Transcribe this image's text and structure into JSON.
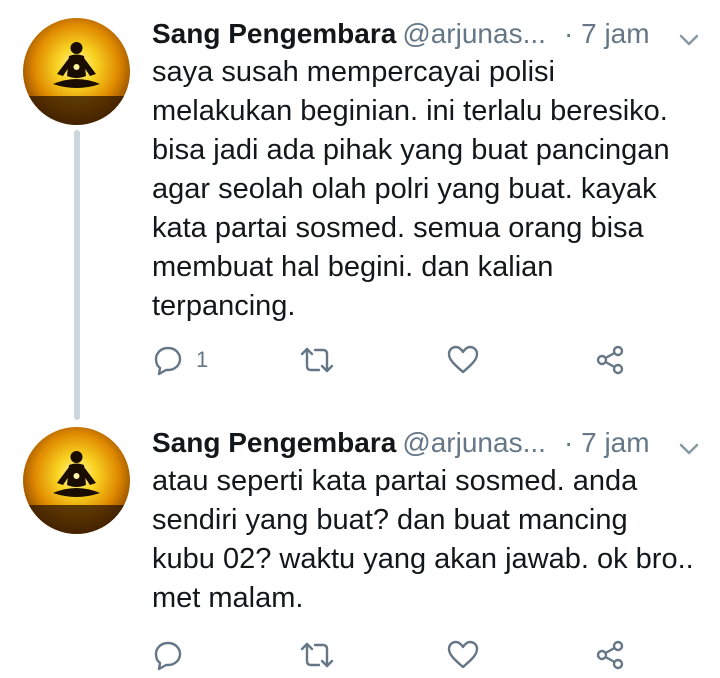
{
  "tweets": [
    {
      "name": "Sang Pengembara",
      "handle": "@arjunas...",
      "time": "· 7 jam",
      "text": "saya susah mempercayai polisi melakukan beginian. ini terlalu beresiko. bisa jadi ada pihak yang buat pancingan agar seolah olah polri yang buat. kayak kata partai sosmed. semua orang bisa membuat hal begini. dan kalian terpancing.",
      "reply_count": "1",
      "icons": {
        "avatar": "meditation-avatar",
        "caret": "chevron-down-icon",
        "reply": "reply-icon",
        "retweet": "retweet-icon",
        "like": "heart-icon",
        "share": "share-icon"
      }
    },
    {
      "name": "Sang Pengembara",
      "handle": "@arjunas...",
      "time": "· 7 jam",
      "text": "atau seperti kata partai sosmed. anda sendiri yang buat? dan buat mancing kubu 02? waktu yang akan jawab. ok bro.. met malam.",
      "reply_count": "",
      "icons": {
        "avatar": "meditation-avatar",
        "caret": "chevron-down-icon",
        "reply": "reply-icon",
        "retweet": "retweet-icon",
        "like": "heart-icon",
        "share": "share-icon"
      }
    }
  ],
  "colors": {
    "text": "#14171a",
    "secondary": "#657786",
    "thread": "#ccd6dd",
    "avatar_glow": "#f7b500"
  }
}
